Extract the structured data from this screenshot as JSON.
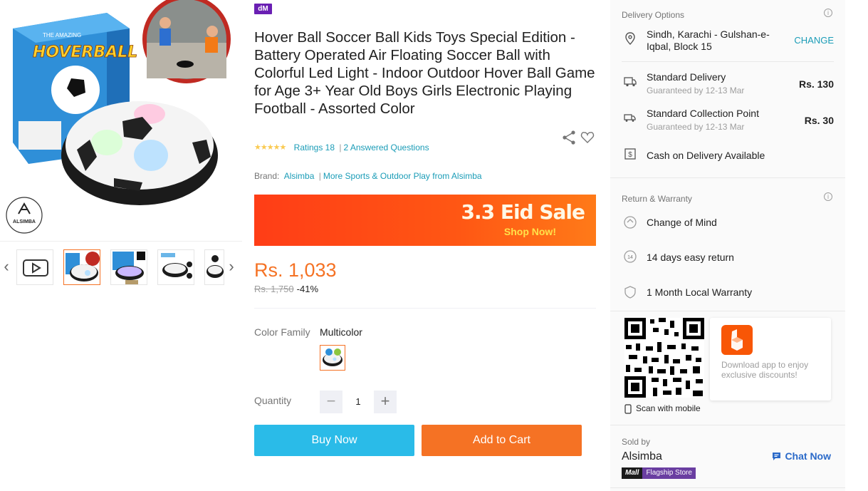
{
  "brand_mark": "dM",
  "product": {
    "title": "Hover Ball Soccer Ball Kids Toys Special Edition - Battery Operated Air Floating Soccer Ball with Colorful Led Light - Indoor Outdoor Hover Ball Game for Age 3+ Year Old Boys Girls Electronic Playing Football - Assorted Color",
    "ratings_link": "Ratings 18",
    "questions_link": "2 Answered Questions",
    "brand_label": "Brand:",
    "brand_name": "Alsimba",
    "more_link": "More Sports & Outdoor Play from Alsimba",
    "banner_title": "3.3 Eid Sale",
    "banner_sub": "Shop Now!",
    "price": "Rs. 1,033",
    "old_price": "Rs. 1,750",
    "discount": "-41%",
    "color_label": "Color Family",
    "color_value": "Multicolor",
    "quantity_label": "Quantity",
    "quantity": "1",
    "buy_now": "Buy Now",
    "add_to_cart": "Add to Cart"
  },
  "gallery": {
    "box_title_small": "THE AMAZING",
    "box_title": "HOVERBALL",
    "logo_text": "ALSIMBA"
  },
  "delivery": {
    "title": "Delivery Options",
    "address": "Sindh, Karachi - Gulshan-e-Iqbal, Block 15",
    "change": "CHANGE",
    "standard_label": "Standard Delivery",
    "standard_sub": "Guaranteed by 12-13 Mar",
    "standard_price": "Rs. 130",
    "collection_label": "Standard Collection Point",
    "collection_sub": "Guaranteed by 12-13 Mar",
    "collection_price": "Rs. 30",
    "cod": "Cash on Delivery Available"
  },
  "warranty": {
    "title": "Return & Warranty",
    "change_of_mind": "Change of Mind",
    "easy_return": "14 days easy return",
    "local_warranty": "1 Month Local Warranty"
  },
  "app": {
    "promo": "Download app to enjoy exclusive discounts!",
    "scan": "Scan with mobile"
  },
  "seller": {
    "label": "Sold by",
    "name": "Alsimba",
    "chat": "Chat Now",
    "badge_mall": "Mall",
    "badge_store": "Flagship Store"
  },
  "colors": {
    "price_orange": "#f57224",
    "buy_blue": "#2abbe8",
    "link_teal": "#1a9cb7"
  },
  "icons": [
    "play-icon",
    "share-icon",
    "heart-icon",
    "location-pin-icon",
    "truck-icon",
    "collection-icon",
    "cash-icon",
    "change-of-mind-icon",
    "return-14-icon",
    "shield-icon",
    "info-icon",
    "phone-icon",
    "chat-icon"
  ]
}
